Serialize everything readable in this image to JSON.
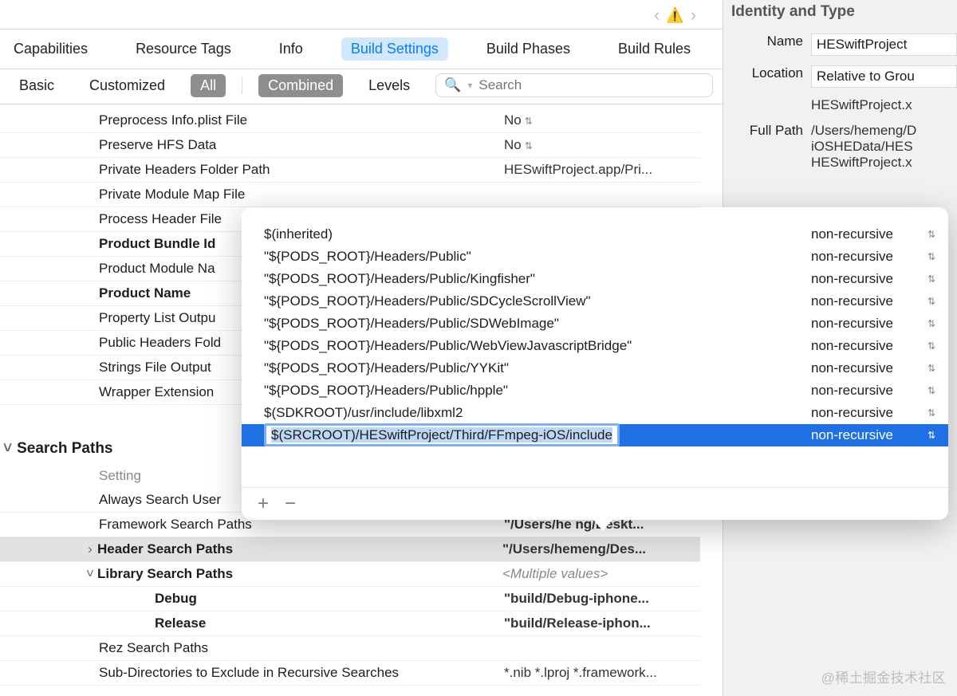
{
  "top_tabs": {
    "capabilities": "Capabilities",
    "resource_tags": "Resource Tags",
    "info": "Info",
    "build_settings": "Build Settings",
    "build_phases": "Build Phases",
    "build_rules": "Build Rules"
  },
  "filter_bar": {
    "basic": "Basic",
    "customized": "Customized",
    "all": "All",
    "combined": "Combined",
    "levels": "Levels",
    "search_placeholder": "Search"
  },
  "settings": {
    "preprocess_info_plist": {
      "key": "Preprocess Info.plist File",
      "val": "No"
    },
    "preserve_hfs": {
      "key": "Preserve HFS Data",
      "val": "No"
    },
    "private_headers_folder": {
      "key": "Private Headers Folder Path",
      "val": "HESwiftProject.app/Pri..."
    },
    "private_module_map": {
      "key": "Private Module Map File",
      "val": ""
    },
    "process_header_file": {
      "key": "Process Header File",
      "val": ""
    },
    "product_bundle_id": {
      "key": "Product Bundle Id",
      "val": ""
    },
    "product_module_name": {
      "key": "Product Module Na",
      "val": ""
    },
    "product_name": {
      "key": "Product Name",
      "val": ""
    },
    "property_list_output": {
      "key": "Property List Outpu",
      "val": ""
    },
    "public_headers_folder": {
      "key": "Public Headers Fold",
      "val": ""
    },
    "strings_file_output": {
      "key": "Strings File Output",
      "val": ""
    },
    "wrapper_extension": {
      "key": "Wrapper Extension",
      "val": ""
    }
  },
  "search_paths": {
    "section_title": "Search Paths",
    "setting_header": "Setting",
    "always_search_user": {
      "key": "Always Search User",
      "val": ""
    },
    "framework_search": {
      "key": "Framework Search Paths",
      "val": "\"/Users/he        ng/Deskt..."
    },
    "header_search": {
      "key": "Header Search Paths",
      "val": "\"/Users/hemeng/Des..."
    },
    "library_search": {
      "key": "Library Search Paths",
      "val": "<Multiple values>"
    },
    "debug": {
      "key": "Debug",
      "val": "\"build/Debug-iphone..."
    },
    "release": {
      "key": "Release",
      "val": "\"build/Release-iphon..."
    },
    "rez_search": {
      "key": "Rez Search Paths",
      "val": ""
    },
    "subdirs_exclude": {
      "key": "Sub-Directories to Exclude in Recursive Searches",
      "val": "*.nib *.lproj *.framework..."
    }
  },
  "inspector": {
    "title": "Identity and Type",
    "name_label": "Name",
    "name_val": "HESwiftProject",
    "location_label": "Location",
    "location_val": "Relative to Grou",
    "location_path": "HESwiftProject.x",
    "fullpath_label": "Full Path",
    "fullpath_val": "/Users/hemeng/D\niOSHEData/HES\nHESwiftProject.x"
  },
  "popover": {
    "rows": [
      {
        "path": "$(inherited)",
        "rec": "non-recursive"
      },
      {
        "path": "\"${PODS_ROOT}/Headers/Public\"",
        "rec": "non-recursive"
      },
      {
        "path": "\"${PODS_ROOT}/Headers/Public/Kingfisher\"",
        "rec": "non-recursive"
      },
      {
        "path": "\"${PODS_ROOT}/Headers/Public/SDCycleScrollView\"",
        "rec": "non-recursive"
      },
      {
        "path": "\"${PODS_ROOT}/Headers/Public/SDWebImage\"",
        "rec": "non-recursive"
      },
      {
        "path": "\"${PODS_ROOT}/Headers/Public/WebViewJavascriptBridge\"",
        "rec": "non-recursive"
      },
      {
        "path": "\"${PODS_ROOT}/Headers/Public/YYKit\"",
        "rec": "non-recursive"
      },
      {
        "path": "\"${PODS_ROOT}/Headers/Public/hpple\"",
        "rec": "non-recursive"
      },
      {
        "path": "$(SDKROOT)/usr/include/libxml2",
        "rec": "non-recursive"
      }
    ],
    "selected": {
      "path": "$(SRCROOT)/HESwiftProject/Third/FFmpeg-iOS/include",
      "rec": "non-recursive"
    }
  },
  "watermark": "@稀土掘金技术社区"
}
